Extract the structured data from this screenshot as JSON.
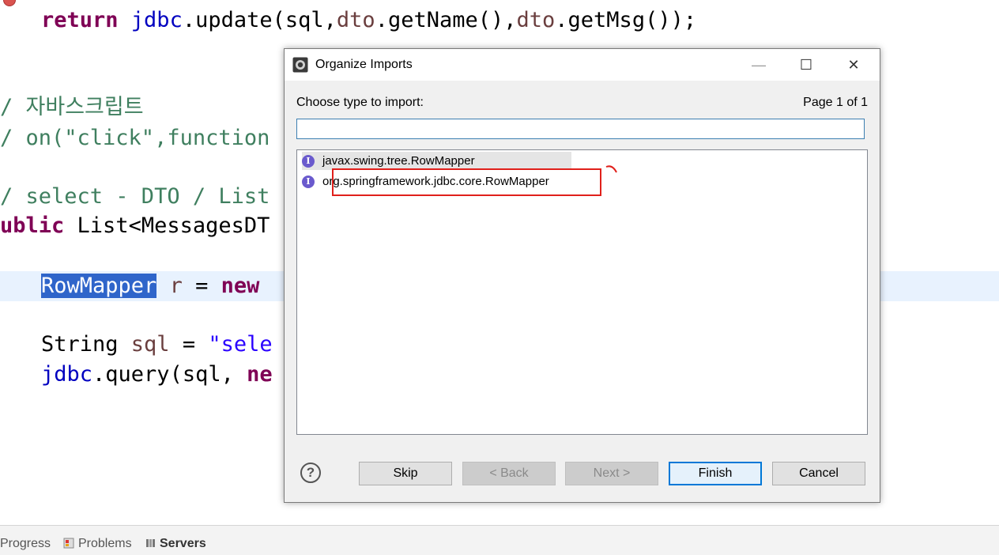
{
  "editor": {
    "lines": [
      {
        "parts": [
          [
            "kw",
            "return "
          ],
          [
            "fld",
            "jdbc"
          ],
          [
            "",
            "."
          ],
          [
            "",
            "update(sql,"
          ],
          [
            "var",
            "dto"
          ],
          [
            "",
            ".getName(),"
          ],
          [
            "var",
            "dto"
          ],
          [
            "",
            ".getMsg());"
          ]
        ]
      },
      {
        "parts": [
          [
            "cmt",
            "/ 자바스크립트"
          ]
        ]
      },
      {
        "parts": [
          [
            "cmt",
            "/ on(\"click\",function"
          ]
        ]
      },
      {
        "parts": [
          [
            "cmt",
            "/ select - DTO / List"
          ]
        ]
      },
      {
        "parts": [
          [
            "kw",
            "ublic "
          ],
          [
            "",
            "List<MessagesDT"
          ]
        ]
      },
      {
        "parts": [
          [
            "sel",
            "RowMapper"
          ],
          [
            "var",
            " r"
          ],
          [
            "",
            " = "
          ],
          [
            "kw",
            "new"
          ]
        ]
      },
      {
        "parts": [
          [
            "",
            "String "
          ],
          [
            "var",
            "sql"
          ],
          [
            "",
            " = "
          ],
          [
            "str",
            "\"sele"
          ]
        ]
      },
      {
        "parts": [
          [
            "fld",
            "jdbc"
          ],
          [
            "",
            ".query(sql, "
          ],
          [
            "kw",
            "ne"
          ]
        ]
      }
    ]
  },
  "bottom_bar": {
    "tabs": [
      {
        "label": "Progress",
        "active": false
      },
      {
        "label": "Problems",
        "active": false,
        "icon": "problems-icon"
      },
      {
        "label": "Servers",
        "active": true,
        "icon": "servers-icon"
      }
    ]
  },
  "dialog": {
    "title": "Organize Imports",
    "minimize_glyph": "—",
    "maximize_glyph": "☐",
    "close_glyph": "✕",
    "prompt": "Choose type to import:",
    "page_info": "Page 1 of 1",
    "filter_value": "",
    "items": [
      {
        "label": "javax.swing.tree.RowMapper",
        "icon": "interface-icon",
        "selected": true
      },
      {
        "label": "org.springframework.jdbc.core.RowMapper",
        "icon": "interface-icon",
        "selected": false,
        "highlighted": true
      }
    ],
    "interface_glyph": "I",
    "help_glyph": "?",
    "buttons": {
      "skip": "Skip",
      "back": "< Back",
      "next": "Next >",
      "finish": "Finish",
      "cancel": "Cancel"
    },
    "annotation_color": "#e0201b"
  }
}
